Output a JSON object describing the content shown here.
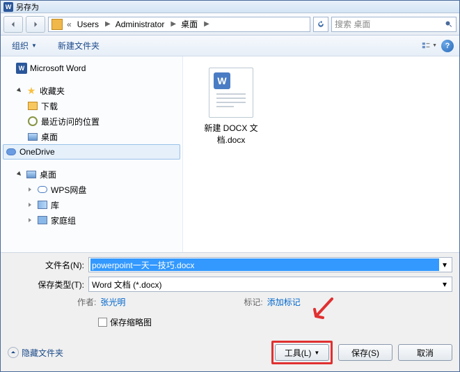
{
  "title": "另存为",
  "breadcrumb": {
    "seg1": "Users",
    "seg2": "Administrator",
    "seg3": "桌面"
  },
  "search": {
    "placeholder": "搜索 桌面"
  },
  "toolbar": {
    "organize": "组织",
    "new_folder": "新建文件夹"
  },
  "tree": {
    "word": "Microsoft Word",
    "favorites": "收藏夹",
    "downloads": "下载",
    "recent": "最近访问的位置",
    "desktop1": "桌面",
    "onedrive": "OneDrive",
    "desktop2": "桌面",
    "wps": "WPS网盘",
    "libraries": "库",
    "homegroup": "家庭组"
  },
  "content": {
    "file1": "新建 DOCX 文档.docx"
  },
  "footer": {
    "filename_label": "文件名(N):",
    "filename_value": "powerpoint一天一技巧.docx",
    "filetype_label": "保存类型(T):",
    "filetype_value": "Word 文档 (*.docx)",
    "author_label": "作者:",
    "author_value": "张光明",
    "tags_label": "标记:",
    "tags_value": "添加标记",
    "thumb_label": "保存缩略图",
    "hide_folders": "隐藏文件夹",
    "tools": "工具(L)",
    "save": "保存(S)",
    "cancel": "取消"
  }
}
